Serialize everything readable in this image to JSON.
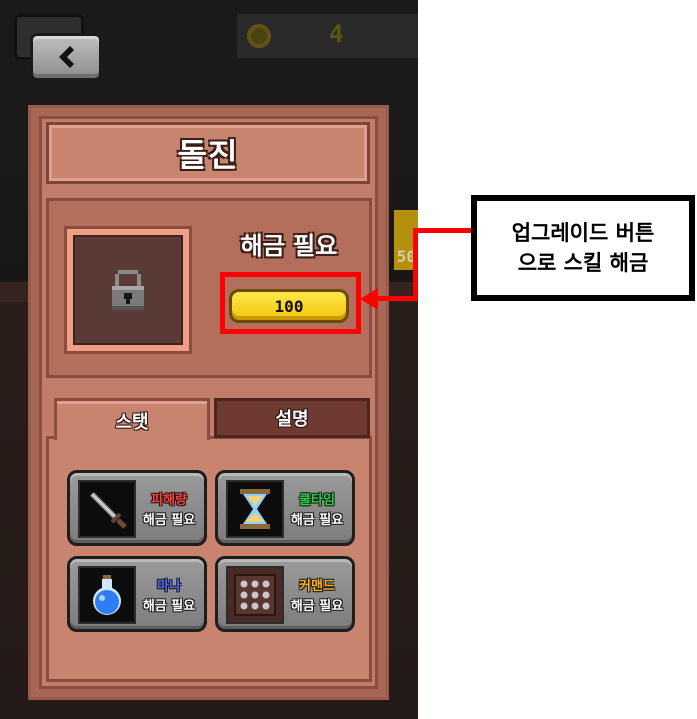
{
  "hud": {
    "coin_count": "4"
  },
  "background": {
    "partial_number": "50"
  },
  "skill_panel": {
    "title": "돌진",
    "unlock_label": "해금 필요",
    "unlock_cost": "100",
    "tabs": [
      {
        "label": "스탯",
        "active": true
      },
      {
        "label": "설명",
        "active": false
      }
    ],
    "skills": [
      {
        "name": "피해량",
        "status": "해금 필요",
        "name_color": "#ff3b3b",
        "icon": "sword-icon"
      },
      {
        "name": "쿨타임",
        "status": "해금 필요",
        "name_color": "#2ecc40",
        "icon": "hourglass-icon"
      },
      {
        "name": "마나",
        "status": "해금 필요",
        "name_color": "#4a6cff",
        "icon": "mana-potion-icon"
      },
      {
        "name": "커맨드",
        "status": "해금 필요",
        "name_color": "#ffb020",
        "icon": "command-grid-icon"
      }
    ]
  },
  "annotation": {
    "line1": "업그레이드 버튼",
    "line2": "으로 스킬 해금"
  },
  "colors": {
    "annotation_red": "#ff0000",
    "cost_button": "#f7d21a",
    "panel": "#c27c6a"
  }
}
